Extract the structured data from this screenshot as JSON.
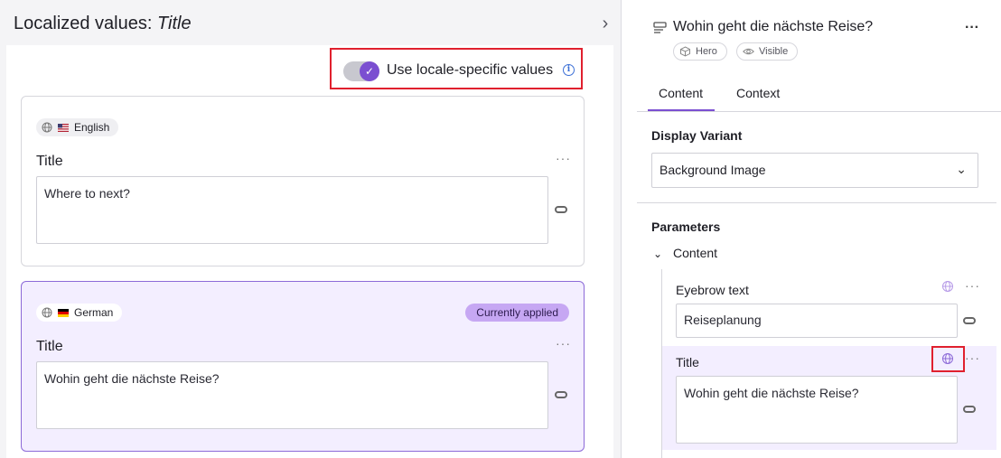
{
  "left_panel": {
    "title_prefix": "Localized values:",
    "title_field": "Title",
    "toggle_label": "Use locale-specific values",
    "toggle_on": true,
    "locales": [
      {
        "name": "English",
        "flag": "US",
        "field_label": "Title",
        "value": "Where to next?",
        "currently_applied": false
      },
      {
        "name": "German",
        "flag": "DE",
        "field_label": "Title",
        "value": "Wohin geht die nächste Reise?",
        "currently_applied": true,
        "badge": "Currently applied"
      }
    ]
  },
  "right_panel": {
    "component_title": "Wohin geht die nächste Reise?",
    "chips": [
      "Hero",
      "Visible"
    ],
    "tabs": [
      "Content",
      "Context"
    ],
    "active_tab": "Content",
    "display_variant": {
      "label": "Display Variant",
      "value": "Background Image"
    },
    "parameters": {
      "label": "Parameters",
      "group": "Content",
      "fields": [
        {
          "label": "Eyebrow text",
          "value": "Reiseplanung"
        },
        {
          "label": "Title",
          "value": "Wohin geht die nächste Reise?"
        }
      ]
    }
  },
  "colors": {
    "accent": "#7b4fd1",
    "applied_badge": "#c6a7f3",
    "selected_bg": "#f3eeff",
    "highlight": "#e0202e"
  }
}
